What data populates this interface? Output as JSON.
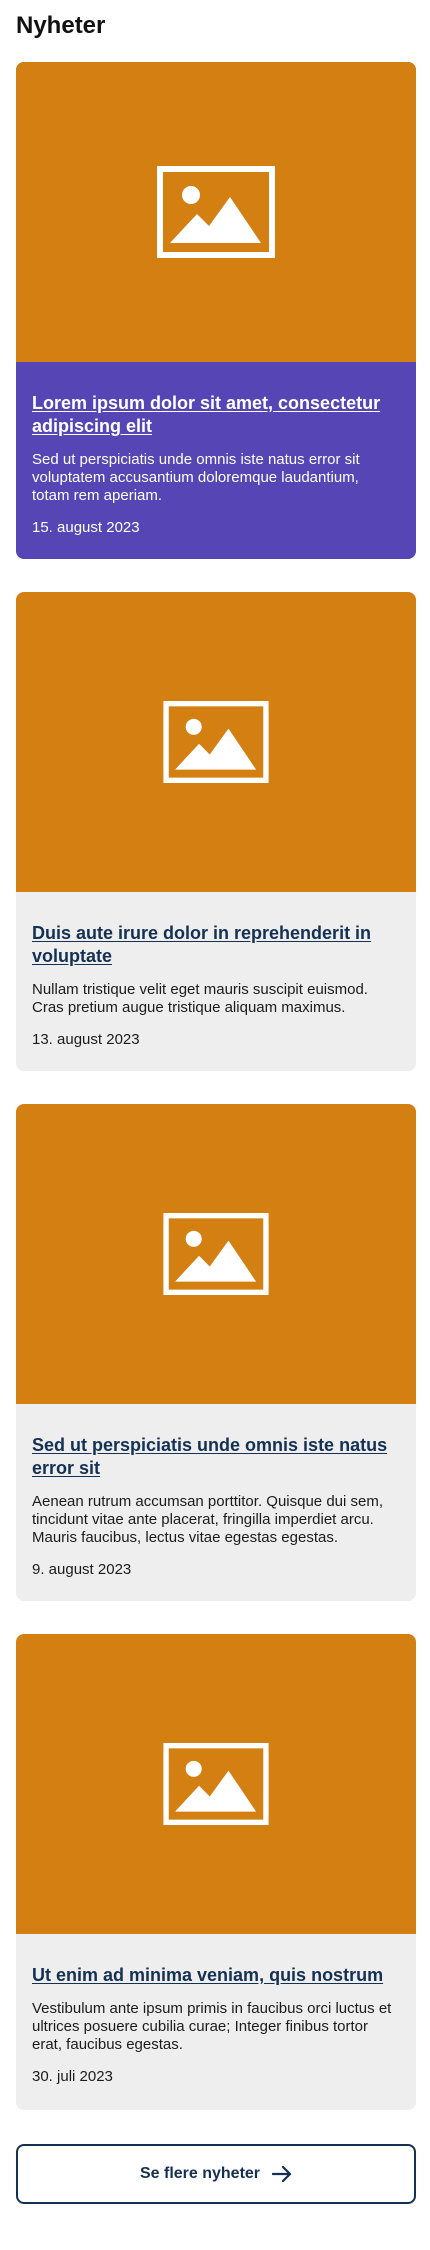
{
  "page": {
    "heading": "Nyheter"
  },
  "colors": {
    "image_placeholder": "#d47f11",
    "featured_card": "#5545b5",
    "card_background": "#eeeeee",
    "link_text": "#143052"
  },
  "news": [
    {
      "title": "Lorem ipsum dolor sit amet, consectetur adipiscing elit",
      "excerpt": "Sed ut perspiciatis unde omnis iste natus error sit voluptatem accusantium doloremque laudantium, totam rem aperiam.",
      "date": "15. august 2023",
      "image_icon": "image-placeholder-icon",
      "featured": true
    },
    {
      "title": "Duis aute irure dolor in reprehenderit in voluptate",
      "excerpt": "Nullam tristique velit eget mauris suscipit euismod. Cras pretium augue tristique aliquam maximus.",
      "date": "13. august 2023",
      "image_icon": "image-placeholder-icon",
      "featured": false
    },
    {
      "title": "Sed ut perspiciatis unde omnis iste natus error sit",
      "excerpt": "Aenean rutrum accumsan porttitor. Quisque dui sem, tincidunt vitae ante placerat, fringilla imperdiet arcu. Mauris faucibus, lectus vitae egestas egestas.",
      "date": "9. august 2023",
      "image_icon": "image-placeholder-icon",
      "featured": false
    },
    {
      "title": "Ut enim ad minima veniam, quis nostrum",
      "excerpt": "Vestibulum ante ipsum primis in faucibus orci luctus et ultrices posuere cubilia curae; Integer finibus tortor erat, faucibus egestas.",
      "date": "30. juli 2023",
      "image_icon": "image-placeholder-icon",
      "featured": false
    }
  ],
  "more_button": {
    "label": "Se flere nyheter",
    "icon": "arrow-right-icon"
  }
}
